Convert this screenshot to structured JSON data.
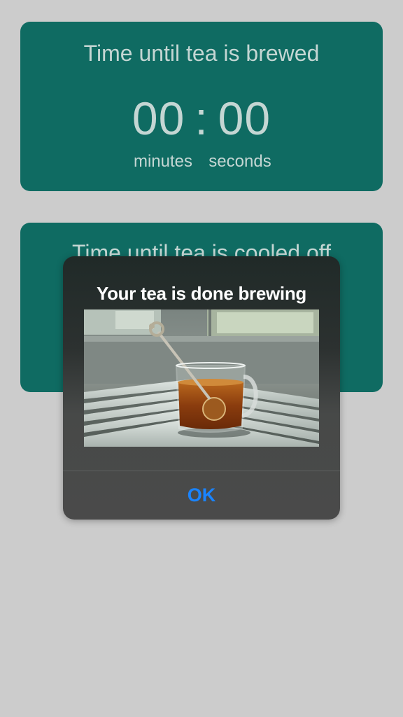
{
  "brew_timer": {
    "title": "Time until tea is brewed",
    "minutes": "00",
    "separator": ":",
    "seconds": "00",
    "minutes_label": "minutes",
    "seconds_label": "seconds"
  },
  "cool_timer": {
    "title": "Time until tea is cooled off"
  },
  "dialog": {
    "title": "Your tea is done brewing",
    "image_alt": "glass mug of tea with infuser on a slatted table",
    "ok_label": "OK"
  },
  "colors": {
    "card_background": "#0f6b62",
    "page_background": "#cccccc",
    "button_accent": "#1a84ff"
  }
}
